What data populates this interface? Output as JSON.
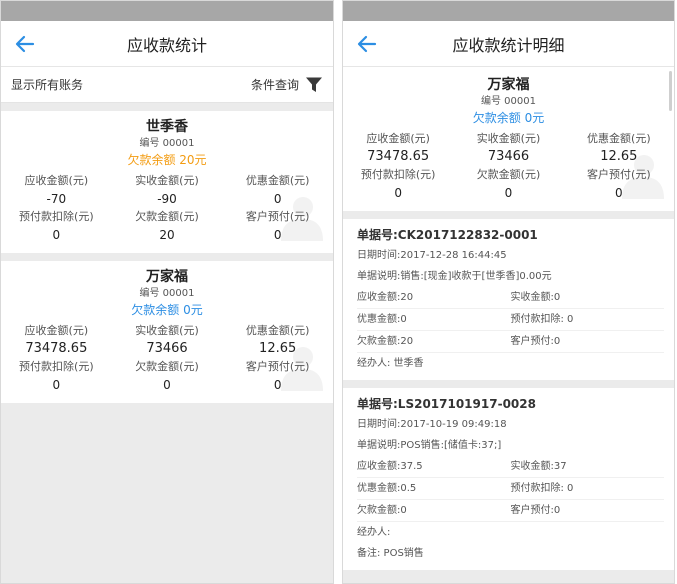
{
  "left": {
    "title": "应收款统计",
    "filter": {
      "show_all": "显示所有账务",
      "query": "条件查询"
    },
    "col_labels": {
      "receivable": "应收金额(元)",
      "received": "实收金额(元)",
      "discount": "优惠金额(元)",
      "prepay_deduct": "预付款扣除(元)",
      "owed": "欠款金额(元)",
      "customer_prepay": "客户预付(元)"
    },
    "cards": [
      {
        "name": "世季香",
        "code": "编号 00001",
        "balance": "欠款余额 20元",
        "receivable": "-70",
        "received": "-90",
        "discount": "0",
        "prepay_deduct": "0",
        "owed": "20",
        "customer_prepay": "0"
      },
      {
        "name": "万家福",
        "code": "编号 00001",
        "balance": "欠款余额 0元",
        "receivable": "73478.65",
        "received": "73466",
        "discount": "12.65",
        "prepay_deduct": "0",
        "owed": "0",
        "customer_prepay": "0"
      }
    ]
  },
  "right": {
    "title": "应收款统计明细",
    "summary": {
      "name": "万家福",
      "code": "编号 00001",
      "balance": "欠款余额 0元",
      "receivable": "73478.65",
      "received": "73466",
      "discount": "12.65",
      "prepay_deduct": "0",
      "owed": "0",
      "customer_prepay": "0"
    },
    "records": [
      {
        "no": "单据号:CK2017122832-0001",
        "datetime": "日期时间:2017-12-28 16:44:45",
        "desc": "单据说明:销售:[现金]收款于[世季香]0.00元",
        "receivable": "应收金额:20",
        "received": "实收金额:0",
        "discount": "优惠金额:0",
        "prepay_deduct": "预付款扣除: 0",
        "owed": "欠款金额:20",
        "customer_prepay": "客户预付:0",
        "handler": "经办人: 世季香"
      },
      {
        "no": "单据号:LS2017101917-0028",
        "datetime": "日期时间:2017-10-19 09:49:18",
        "desc": "单据说明:POS销售:[储值卡:37;]",
        "receivable": "应收金额:37.5",
        "received": "实收金额:37",
        "discount": "优惠金额:0.5",
        "prepay_deduct": "预付款扣除: 0",
        "owed": "欠款金额:0",
        "customer_prepay": "客户预付:0",
        "handler": "经办人:",
        "remark": "备注: POS销售"
      }
    ]
  },
  "colors": {
    "accent": "#2c8ee3",
    "warning": "#f39c12",
    "status_bar": "#a7a7a7"
  },
  "icons": {
    "back": "arrow-left-icon",
    "filter": "funnel-icon",
    "watermark": "person-icon"
  }
}
